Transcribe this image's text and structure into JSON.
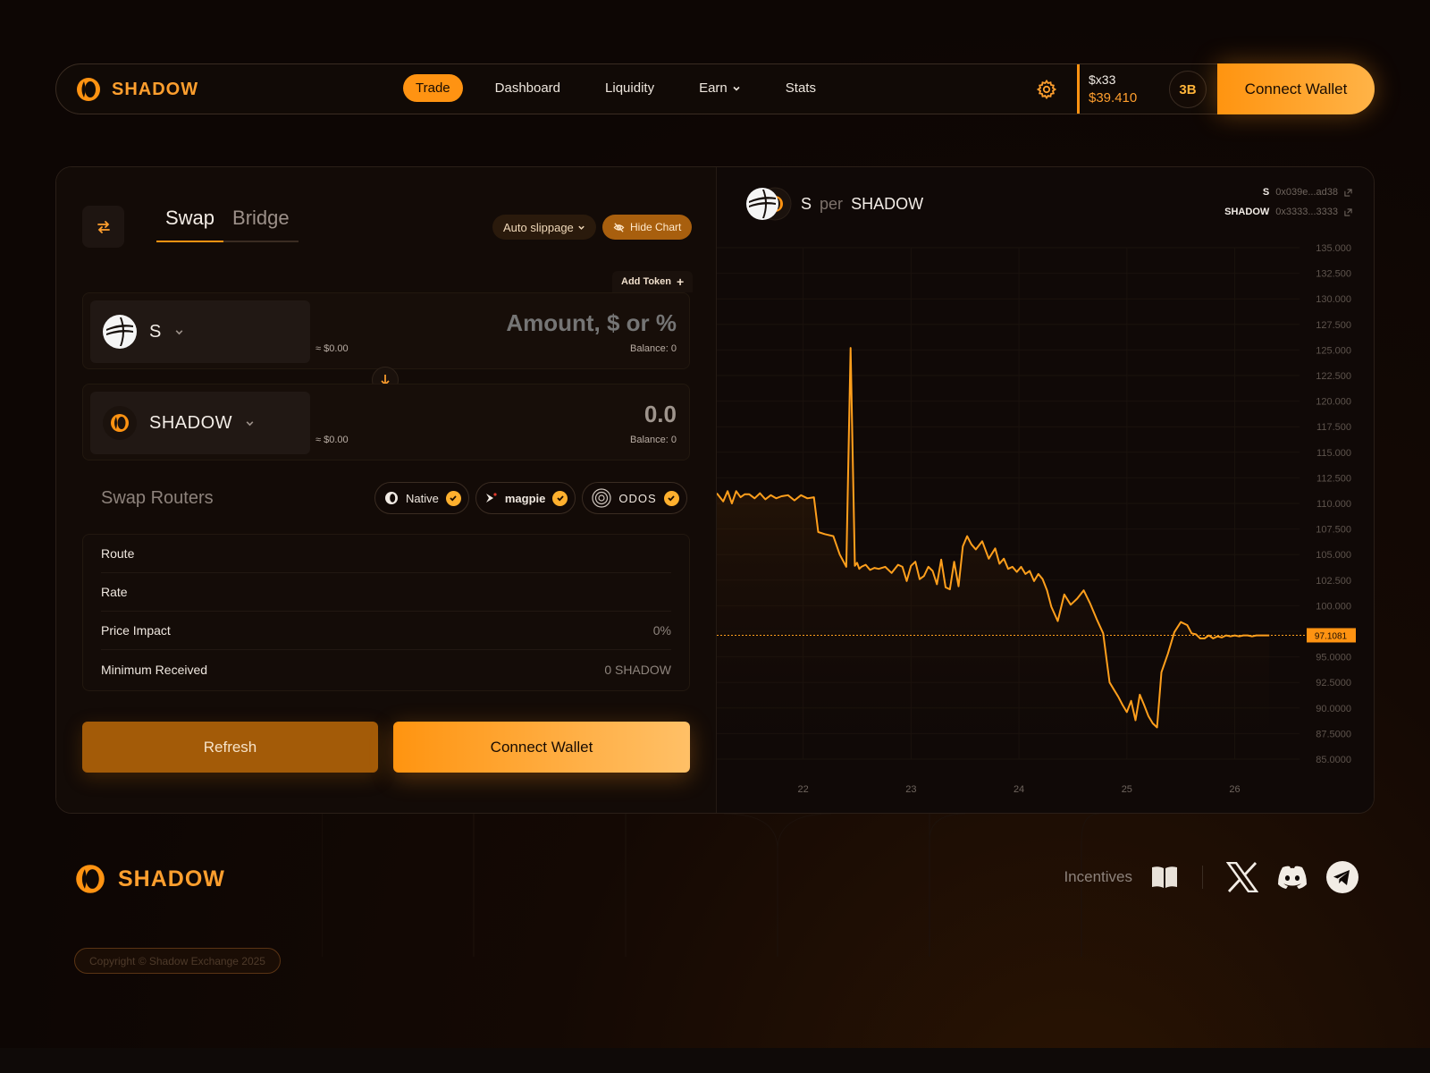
{
  "brand": {
    "name": "SHADOW"
  },
  "nav": {
    "links": [
      {
        "label": "Trade",
        "active": true
      },
      {
        "label": "Dashboard"
      },
      {
        "label": "Liquidity"
      },
      {
        "label": "Earn"
      },
      {
        "label": "Stats"
      }
    ],
    "balance_token": "$x33",
    "balance_value": "$39.410",
    "badge": "3B",
    "connect_label": "Connect Wallet"
  },
  "swap": {
    "tabs": [
      "Swap",
      "Bridge"
    ],
    "slippage_label": "Auto slippage",
    "hide_chart_label": "Hide Chart",
    "add_token_label": "Add Token",
    "from": {
      "symbol": "S",
      "usd": "≈ $0.00",
      "amount_placeholder": "Amount, $ or %",
      "balance": "Balance: 0"
    },
    "to": {
      "symbol": "SHADOW",
      "usd": "≈ $0.00",
      "amount": "0.0",
      "balance": "Balance: 0"
    },
    "routers_title": "Swap Routers",
    "routers": [
      {
        "name": "Native",
        "icon": "shadow-icon"
      },
      {
        "name": "magpie",
        "icon": "magpie-icon"
      },
      {
        "name": "ODOS",
        "icon": "odos-icon"
      }
    ],
    "details": [
      {
        "label": "Route",
        "value": ""
      },
      {
        "label": "Rate",
        "value": ""
      },
      {
        "label": "Price Impact",
        "value": "0%"
      },
      {
        "label": "Minimum Received",
        "value": "0 SHADOW"
      }
    ],
    "refresh_label": "Refresh",
    "connect_label": "Connect Wallet"
  },
  "chart_header": {
    "base": "S",
    "per": "per",
    "quote": "SHADOW",
    "addresses": [
      {
        "symbol": "S",
        "address": "0x039e...ad38"
      },
      {
        "symbol": "SHADOW",
        "address": "0x3333...3333"
      }
    ]
  },
  "chart_data": {
    "type": "area",
    "title": "S per SHADOW",
    "y_ticks": [
      135.0,
      132.5,
      130.0,
      127.5,
      125.0,
      122.5,
      120.0,
      117.5,
      115.0,
      112.5,
      110.0,
      107.5,
      105.0,
      102.5,
      100.0,
      97.5,
      95.0,
      92.5,
      90.0,
      87.5,
      85.0
    ],
    "y_tick_labels": [
      "135.000",
      "132.500",
      "130.000",
      "127.500",
      "125.000",
      "122.500",
      "120.000",
      "117.500",
      "115.000",
      "112.500",
      "110.000",
      "107.500",
      "105.000",
      "102.500",
      "100.000",
      "95.0000",
      "92.5000",
      "90.0000",
      "87.5000",
      "85.0000"
    ],
    "ylim": [
      85.0,
      135.0
    ],
    "x_tick_labels": [
      "22",
      "23",
      "24",
      "25",
      "26"
    ],
    "xlim": [
      21.2,
      26.6
    ],
    "x_ticks": [
      22,
      23,
      24,
      25,
      26
    ],
    "current_price": 97.1081,
    "current_price_label": "97.1081",
    "grid": true,
    "series": [
      {
        "color": "#ff9f1c",
        "x": [
          21.2,
          21.26,
          21.3,
          21.34,
          21.38,
          21.42,
          21.46,
          21.5,
          21.55,
          21.6,
          21.65,
          21.7,
          21.75,
          21.8,
          21.86,
          21.92,
          21.98,
          22.04,
          22.1,
          22.14,
          22.2,
          22.28,
          22.34,
          22.4,
          22.44,
          22.48,
          22.5,
          22.52,
          22.54,
          22.58,
          22.62,
          22.66,
          22.7,
          22.76,
          22.82,
          22.88,
          22.92,
          22.96,
          23.0,
          23.04,
          23.08,
          23.12,
          23.16,
          23.2,
          23.24,
          23.28,
          23.32,
          23.36,
          23.4,
          23.44,
          23.48,
          23.52,
          23.56,
          23.6,
          23.66,
          23.72,
          23.78,
          23.82,
          23.86,
          23.9,
          23.94,
          23.98,
          24.02,
          24.06,
          24.1,
          24.14,
          24.18,
          24.22,
          24.26,
          24.3,
          24.36,
          24.42,
          24.48,
          24.54,
          24.6,
          24.66,
          24.72,
          24.78,
          24.84,
          24.88,
          24.92,
          24.96,
          25.0,
          25.04,
          25.08,
          25.12,
          25.16,
          25.2,
          25.24,
          25.28,
          25.32,
          25.38,
          25.44,
          25.5,
          25.56,
          25.6,
          25.64,
          25.68,
          25.72,
          25.76,
          25.8,
          25.84,
          25.88,
          25.92,
          25.96,
          26.0,
          26.04,
          26.08,
          26.12,
          26.16,
          26.2,
          26.26,
          26.32
        ],
        "y": [
          111.0,
          110.2,
          111.2,
          110.0,
          111.2,
          110.6,
          110.9,
          110.9,
          110.5,
          111.0,
          110.4,
          110.8,
          110.5,
          110.7,
          110.8,
          110.3,
          110.8,
          110.5,
          110.6,
          107.2,
          107.0,
          106.8,
          105.0,
          103.8,
          125.2,
          103.9,
          104.2,
          103.6,
          103.8,
          104.0,
          103.5,
          103.7,
          103.6,
          103.8,
          103.2,
          104.0,
          103.8,
          102.4,
          103.9,
          104.3,
          102.6,
          102.9,
          103.8,
          103.4,
          102.1,
          104.5,
          101.8,
          101.6,
          104.3,
          101.9,
          105.8,
          106.8,
          106.0,
          105.5,
          106.3,
          104.6,
          105.6,
          104.1,
          104.6,
          103.6,
          103.8,
          103.3,
          103.8,
          103.1,
          103.4,
          102.4,
          103.1,
          102.6,
          101.5,
          99.9,
          98.5,
          101.1,
          100.1,
          100.7,
          101.5,
          100.2,
          98.7,
          97.3,
          92.5,
          91.8,
          91.1,
          90.3,
          89.6,
          90.7,
          88.8,
          91.3,
          90.3,
          89.2,
          88.5,
          88.1,
          93.5,
          95.3,
          97.4,
          98.4,
          98.1,
          97.3,
          97.2,
          96.8,
          96.8,
          97.1,
          96.8,
          97.0,
          96.9,
          97.1,
          97.0,
          97.1,
          97.0,
          97.1,
          97.1,
          97.0,
          97.1,
          97.1,
          97.1
        ]
      }
    ]
  },
  "footer": {
    "incentives_label": "Incentives",
    "copyright": "Copyright © Shadow Exchange 2025"
  }
}
